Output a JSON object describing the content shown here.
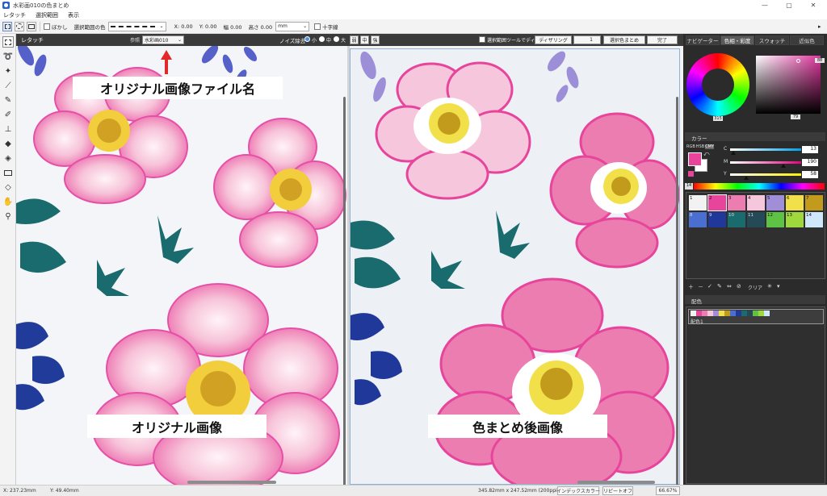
{
  "window": {
    "title": "水彩画010の色まとめ",
    "controls": [
      "—",
      "▢",
      "✕"
    ]
  },
  "menu": [
    "レタッチ",
    "選択範囲",
    "表示"
  ],
  "options_bar": {
    "blur_label": "ぼかし",
    "selection_color_label": "選択範囲の色",
    "x_label": "X: 0.00",
    "y_label": "Y: 0.00",
    "w_label": "幅 0.00",
    "h_label": "高さ 0.00",
    "unit": "mm",
    "crosshair_label": "十字線"
  },
  "panel_header": {
    "title": "レタッチ",
    "ref_label": "参照",
    "ref_value": "水彩画010",
    "noise_label": "ノイズ除去",
    "noise_options": [
      "小",
      "中",
      "大"
    ],
    "btn_weak": "弱",
    "btn_mid": "中",
    "btn_strong": "強",
    "sel_tool_label": "選択範囲ツールでディザ",
    "dither_button": "ディザリング",
    "dither_value": "1",
    "merge_button": "選択色まとめ",
    "done_button": "完了"
  },
  "annotations": {
    "filename_label": "オリジナル画像ファイル名",
    "original_label": "オリジナル画像",
    "after_label": "色まとめ後画像"
  },
  "status": {
    "x": "X: 237.23mm",
    "y": "Y: 49.40mm",
    "size": "345.82mm x 247.52mm (200ppi)",
    "index_color": "インデックスカラー",
    "repeat_off": "リピートオフ",
    "zoom": "66.67%"
  },
  "right_panel": {
    "tabs": [
      "ナビゲーター",
      "色相・彩度",
      "スウォッチ",
      "近似色"
    ],
    "hue_value": "315",
    "sat_top": "88",
    "bright_value": "79",
    "color_header": "カラー",
    "mode_tags": [
      "RGB",
      "HSB",
      "CMY"
    ],
    "sliders": [
      {
        "label": "C",
        "value": "13",
        "level": 0.05
      },
      {
        "label": "M",
        "value": "190",
        "level": 0.75
      },
      {
        "label": "Y",
        "value": "58",
        "level": 0.23
      }
    ],
    "index_num": "14",
    "swatch_cells": [
      {
        "n": "1",
        "color": "#f2f2f2"
      },
      {
        "n": "2",
        "color": "#e7459b"
      },
      {
        "n": "3",
        "color": "#ec7db0"
      },
      {
        "n": "4",
        "color": "#f6c6dd"
      },
      {
        "n": "5",
        "color": "#a08ed8"
      },
      {
        "n": "6",
        "color": "#f2e04a"
      },
      {
        "n": "7",
        "color": "#c39b1c"
      },
      {
        "n": "8",
        "color": "#4b6fd0"
      },
      {
        "n": "9",
        "color": "#20389a"
      },
      {
        "n": "10",
        "color": "#1a6b6e"
      },
      {
        "n": "11",
        "color": "#244a58"
      },
      {
        "n": "12",
        "color": "#5ec244"
      },
      {
        "n": "13",
        "color": "#9fd83d"
      },
      {
        "n": "14",
        "color": "#cfe7fb"
      }
    ],
    "swatch_clear": "クリア",
    "palette_header": "配色",
    "palette_item": "配色1",
    "current_color": "#e7459b",
    "back_color": "#ffffff"
  },
  "colors": {
    "accent_red": "#e02a2a",
    "selection_blue": "#8fb1d6",
    "panel_dark": "#2b2b2b"
  }
}
